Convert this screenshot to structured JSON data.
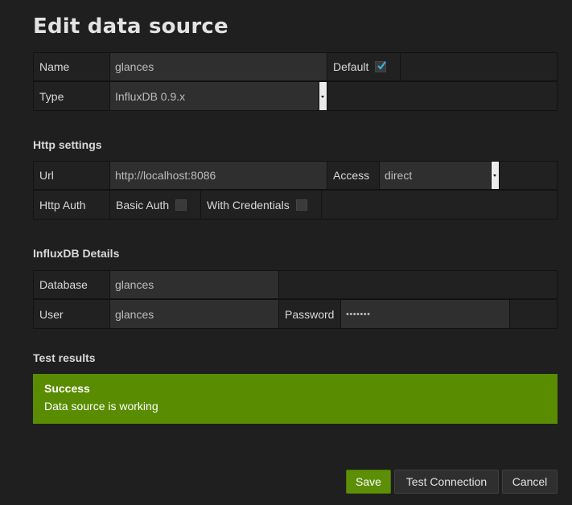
{
  "page": {
    "title": "Edit data source"
  },
  "general": {
    "name_label": "Name",
    "name_value": "glances",
    "default_label": "Default",
    "default_checked": true,
    "type_label": "Type",
    "type_value": "InfluxDB 0.9.x"
  },
  "http": {
    "title": "Http settings",
    "url_label": "Url",
    "url_value": "http://localhost:8086",
    "access_label": "Access",
    "access_value": "direct",
    "auth_label": "Http Auth",
    "basic_auth_label": "Basic Auth",
    "basic_auth_checked": false,
    "with_credentials_label": "With Credentials",
    "with_credentials_checked": false
  },
  "influx": {
    "title": "InfluxDB Details",
    "database_label": "Database",
    "database_value": "glances",
    "user_label": "User",
    "user_value": "glances",
    "password_label": "Password",
    "password_value": "•••••••"
  },
  "test": {
    "title": "Test results",
    "status": "Success",
    "message": "Data source is working"
  },
  "actions": {
    "save": "Save",
    "test_connection": "Test Connection",
    "cancel": "Cancel"
  },
  "colors": {
    "background": "#1f1f20",
    "success": "#598c00",
    "accent_check": "#33b5e5"
  }
}
